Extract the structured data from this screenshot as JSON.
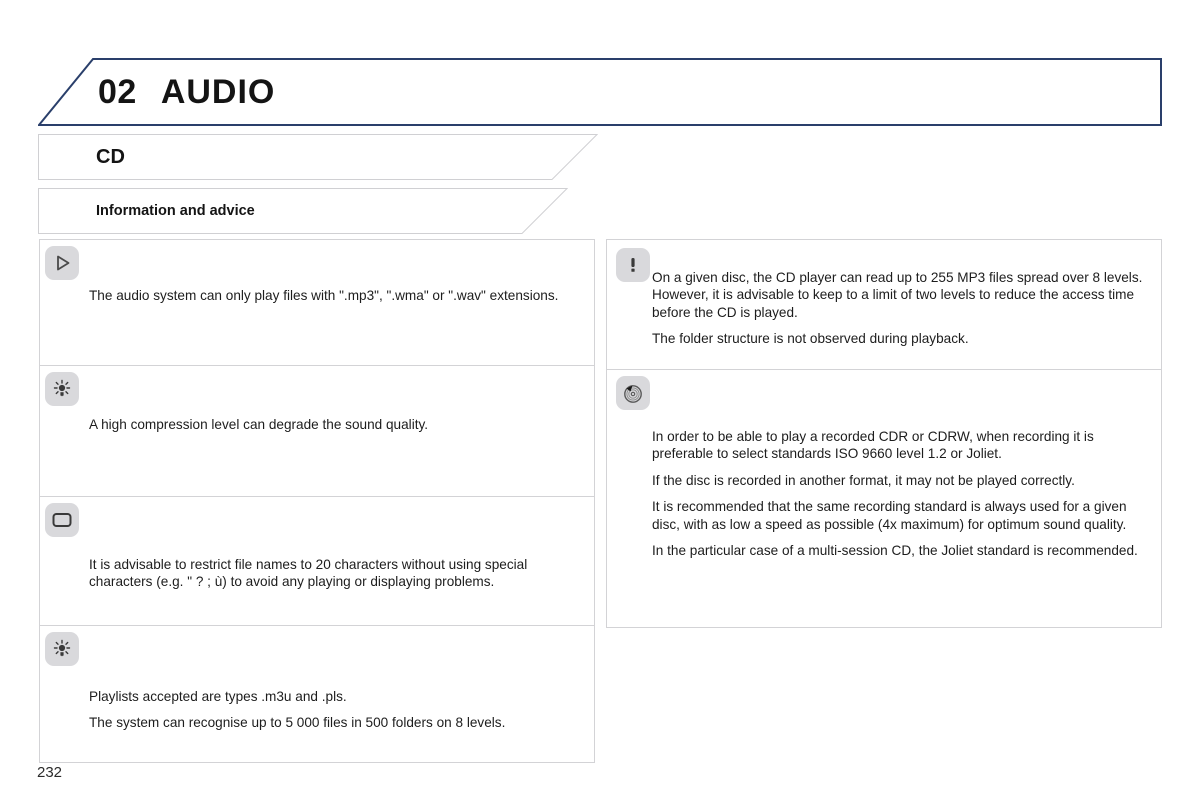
{
  "document": {
    "page_number": "232",
    "chapter": {
      "number": "02",
      "title": "AUDIO"
    },
    "section": {
      "title": "CD",
      "subsection": "Information and advice"
    },
    "colors": {
      "chapter_border": "#2a3f6b",
      "ribbon_border": "#d0d0d3",
      "panel_border": "#d3d3d6",
      "icon_background": "#d9d9dc",
      "text": "#1d1d1d"
    }
  },
  "left_column": {
    "notes": [
      {
        "icon": "play-triangle-icon",
        "paragraphs": [
          "The audio system can only play files with \".mp3\", \".wma\" or \".wav\" extensions."
        ]
      },
      {
        "icon": "light-bulb-icon",
        "paragraphs": [
          "A high compression level can degrade the sound quality."
        ]
      },
      {
        "icon": "display-screen-icon",
        "paragraphs": [
          "It is advisable to restrict file names to 20 characters without using special characters (e.g. \" ? ; ù) to avoid any playing or displaying problems."
        ]
      },
      {
        "icon": "light-bulb-icon",
        "paragraphs": [
          "Playlists accepted are types .m3u and .pls.",
          "The system can recognise up to 5 000 files in 500 folders on 8 levels."
        ]
      }
    ]
  },
  "right_column": {
    "notes": [
      {
        "icon": "warning-exclamation-icon",
        "paragraphs": [
          "On a given disc, the CD player can read up to 255 MP3 files spread over 8 levels. However, it is advisable to keep to a limit of two levels to reduce the access time before the CD is played.",
          "The folder structure is not observed during playback."
        ]
      },
      {
        "icon": "cd-recording-icon",
        "paragraphs": [
          "In order to be able to play a recorded CDR or CDRW, when recording it is preferable to select standards ISO 9660 level 1.2 or Joliet.",
          "If the disc is recorded in another format, it may not be played correctly.",
          "It is recommended that the same recording standard is always used for a given disc, with as low a speed as possible (4x maximum) for optimum sound quality.",
          "In the particular case of a multi-session CD, the Joliet standard is recommended."
        ]
      }
    ]
  }
}
